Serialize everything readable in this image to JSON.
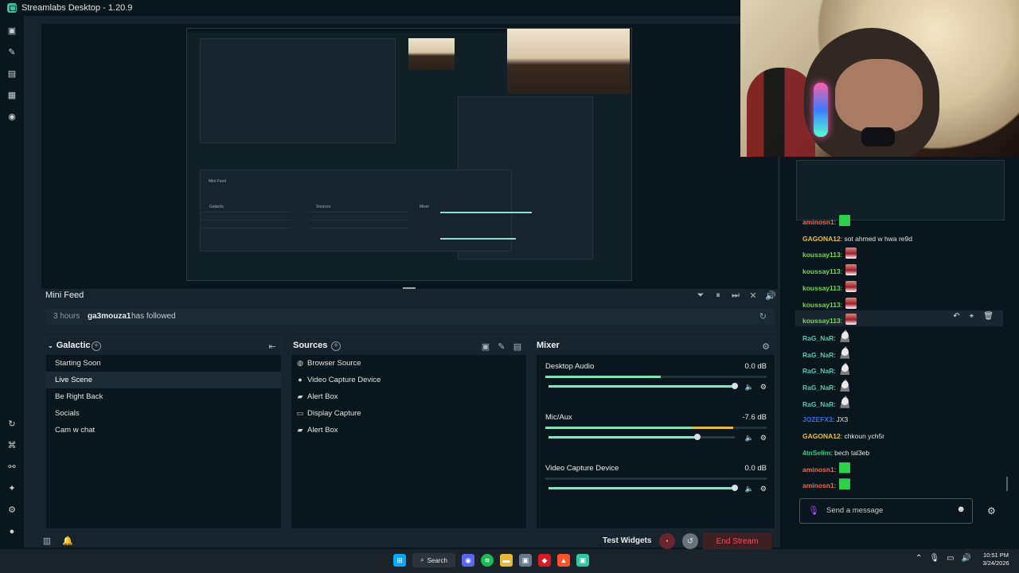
{
  "window": {
    "title": "Streamlabs Desktop - 1.20.9"
  },
  "mini_feed": {
    "title": "Mini Feed",
    "event": {
      "time": "3 hours",
      "user": "ga3mouza1",
      "action": "has followed"
    }
  },
  "scenes": {
    "collection": "Galactic",
    "items": [
      "Starting Soon",
      "Live Scene",
      "Be Right Back",
      "Socials",
      "Cam w chat"
    ],
    "active": "Live Scene"
  },
  "sources": {
    "title": "Sources",
    "items": [
      {
        "icon": "globe-icon",
        "label": "Browser Source"
      },
      {
        "icon": "camera-icon",
        "label": "Video Capture Device"
      },
      {
        "icon": "alert-icon",
        "label": "Alert Box"
      },
      {
        "icon": "monitor-icon",
        "label": "Display Capture"
      },
      {
        "icon": "alert-icon",
        "label": "Alert Box"
      }
    ]
  },
  "mixer": {
    "title": "Mixer",
    "items": [
      {
        "name": "Desktop Audio",
        "db": "0.0 dB",
        "meter": 0.52,
        "slider": 1.0
      },
      {
        "name": "Mic/Aux",
        "db": "-7.6 dB",
        "meter": 0.85,
        "slider": 0.8
      },
      {
        "name": "Video Capture Device",
        "db": "0.0 dB",
        "meter": 0.0,
        "slider": 1.0
      }
    ]
  },
  "bottom": {
    "test_widgets": "Test Widgets",
    "end_stream": "End Stream"
  },
  "chat": {
    "messages": [
      {
        "user": "aminosn1",
        "sep": ":",
        "text": "",
        "emote": "green",
        "color": "#f16b4a"
      },
      {
        "user": "GAGONA12",
        "sep": ":",
        "text": "sot ahmed w hwa re9d",
        "emote": "",
        "color": "#e8bf3e"
      },
      {
        "user": "koussay113",
        "sep": ":",
        "text": "",
        "emote": "red",
        "color": "#7bd453"
      },
      {
        "user": "koussay113",
        "sep": ":",
        "text": "",
        "emote": "red",
        "color": "#7bd453"
      },
      {
        "user": "koussay113",
        "sep": ":",
        "text": "",
        "emote": "red",
        "color": "#7bd453"
      },
      {
        "user": "koussay113",
        "sep": ":",
        "text": "",
        "emote": "red",
        "color": "#7bd453"
      },
      {
        "user": "koussay113",
        "sep": ":",
        "text": "",
        "emote": "red",
        "color": "#7bd453"
      },
      {
        "user": "RaG_NaR",
        "sep": ":",
        "text": "",
        "emote": "goat",
        "color": "#4cc9b3"
      },
      {
        "user": "RaG_NaR",
        "sep": ":",
        "text": "",
        "emote": "goat",
        "color": "#4cc9b3"
      },
      {
        "user": "RaG_NaR",
        "sep": ":",
        "text": "",
        "emote": "goat",
        "color": "#4cc9b3"
      },
      {
        "user": "RaG_NaR",
        "sep": ":",
        "text": "",
        "emote": "goat",
        "color": "#4cc9b3"
      },
      {
        "user": "RaG_NaR",
        "sep": ":",
        "text": "",
        "emote": "goat",
        "color": "#4cc9b3"
      },
      {
        "user": "JOZEFX3",
        "sep": ":",
        "text": "JX3",
        "emote": "",
        "color": "#2e6ff2"
      },
      {
        "user": "GAGONA12",
        "sep": ":",
        "text": "chkoun ych5r",
        "emote": "",
        "color": "#e8bf3e"
      },
      {
        "user": "4tnSelim",
        "sep": ":",
        "text": "bech tal3eb",
        "emote": "",
        "color": "#27d07b"
      },
      {
        "user": "aminosn1",
        "sep": ":",
        "text": "",
        "emote": "green",
        "color": "#f16b4a"
      },
      {
        "user": "aminosn1",
        "sep": ":",
        "text": "",
        "emote": "green",
        "color": "#f16b4a"
      }
    ],
    "input_placeholder": "Send a message"
  },
  "taskbar": {
    "search": "Search",
    "time": "10:51 PM",
    "date": "3/24/2026"
  }
}
